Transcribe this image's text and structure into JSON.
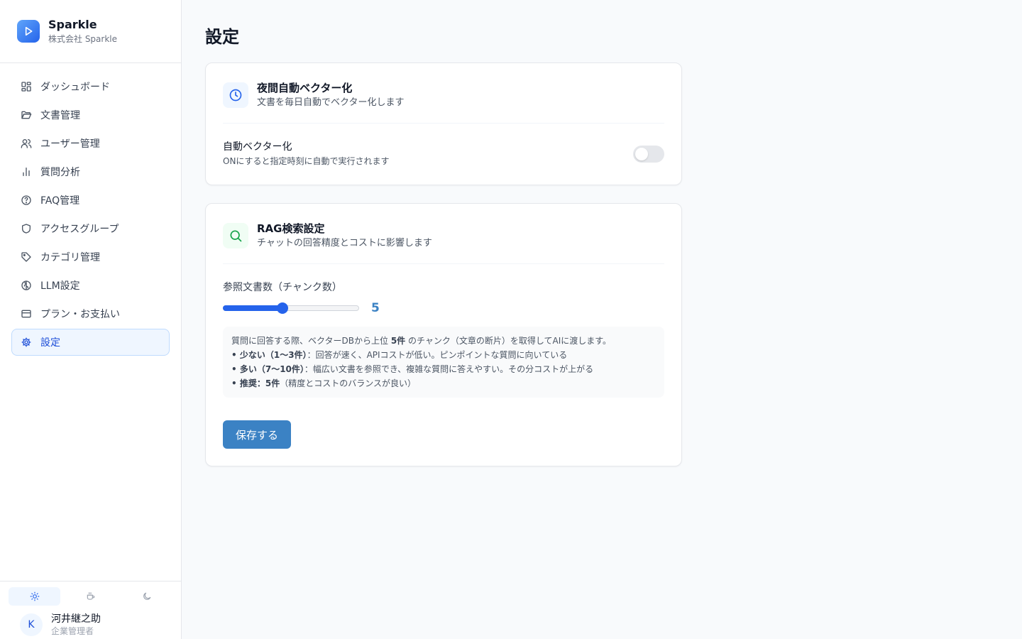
{
  "brand": {
    "name": "Sparkle",
    "company": "株式会社 Sparkle"
  },
  "nav": [
    {
      "label": "ダッシュボード",
      "icon": "dashboard-icon"
    },
    {
      "label": "文書管理",
      "icon": "folder-icon"
    },
    {
      "label": "ユーザー管理",
      "icon": "users-icon"
    },
    {
      "label": "質問分析",
      "icon": "bar-chart-icon"
    },
    {
      "label": "FAQ管理",
      "icon": "help-circle-icon"
    },
    {
      "label": "アクセスグループ",
      "icon": "shield-icon"
    },
    {
      "label": "カテゴリ管理",
      "icon": "tag-icon"
    },
    {
      "label": "LLM設定",
      "icon": "brain-icon"
    },
    {
      "label": "プラン・お支払い",
      "icon": "credit-card-icon"
    },
    {
      "label": "設定",
      "icon": "gear-icon",
      "active": true
    }
  ],
  "theme": {
    "options": [
      "sun-icon",
      "coffee-icon",
      "moon-icon"
    ],
    "selected": "sun-icon"
  },
  "user": {
    "initial": "K",
    "name": "河井継之助",
    "role": "企業管理者"
  },
  "page": {
    "title": "設定"
  },
  "auto_vector": {
    "title": "夜間自動ベクター化",
    "description": "文書を毎日自動でベクター化します",
    "toggle_label": "自動ベクター化",
    "toggle_help": "ONにすると指定時刻に自動で実行されます",
    "enabled": false
  },
  "rag": {
    "title": "RAG検索設定",
    "description": "チャットの回答精度とコストに影響します",
    "chunk_label": "参照文書数（チャンク数）",
    "chunk_value": "5",
    "chunk_fraction": 0.44,
    "info": {
      "line1_pre": "質問に回答する際、ベクターDBから上位 ",
      "line1_bold": "5件",
      "line1_post": " のチャンク（文章の断片）を取得してAIに渡します。",
      "line2_bold": "• 少ない（1〜3件）",
      "line2_post": "：回答が速く、APIコストが低い。ピンポイントな質問に向いている",
      "line3_bold": "• 多い（7〜10件）",
      "line3_post": "：幅広い文書を参照でき、複雑な質問に答えやすい。その分コストが上がる",
      "line4_bold": "• 推奨：5件",
      "line4_post": "（精度とコストのバランスが良い）"
    },
    "save_label": "保存する"
  },
  "colors": {
    "accent": "#2563eb",
    "save_button": "#3b82c4",
    "active_nav_bg": "#eff6ff"
  }
}
